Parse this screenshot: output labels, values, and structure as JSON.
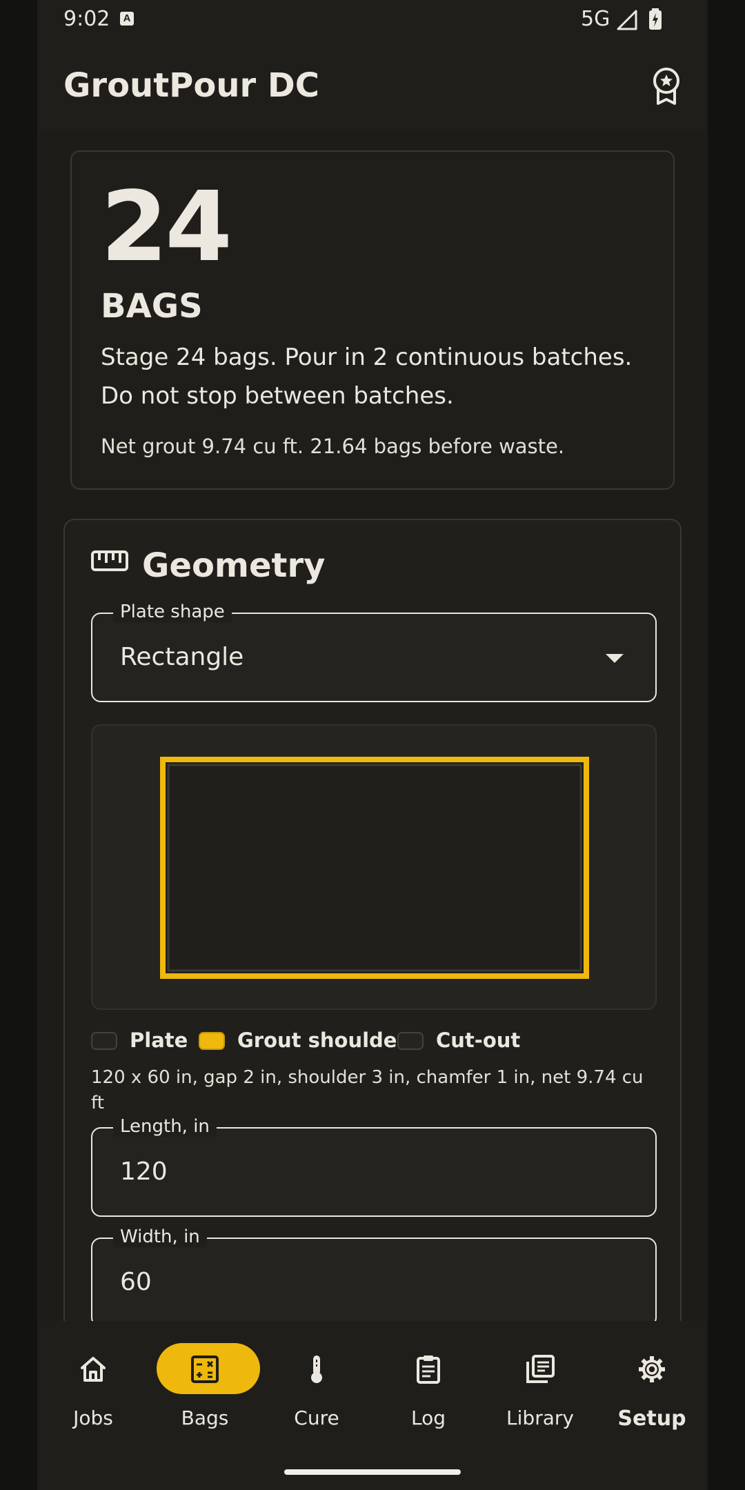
{
  "status_bar": {
    "time": "9:02",
    "notification_icon": "A",
    "network": "5G",
    "signal_icon": "signal-icon",
    "battery_icon": "battery-charging-icon"
  },
  "app_bar": {
    "title": "GroutPour DC",
    "action_icon": "award-icon"
  },
  "result": {
    "bag_count": "24",
    "unit": "BAGS",
    "instruction": "Stage 24 bags. Pour in 2 continuous batches. Do not stop between batches.",
    "net_summary": "Net grout 9.74 cu ft. 21.64 bags before waste."
  },
  "geometry": {
    "title": "Geometry",
    "icon": "ruler-icon",
    "plate_shape_label": "Plate shape",
    "plate_shape_value": "Rectangle",
    "legend": [
      {
        "label": "Plate",
        "color": "#26241f"
      },
      {
        "label": "Grout shoulder",
        "color": "#efb80d"
      },
      {
        "label": "Cut-out",
        "color": "#26241f"
      }
    ],
    "dims_summary": "120 x 60 in, gap 2 in, shoulder 3 in, chamfer 1 in, net 9.74 cu ft",
    "length_label": "Length, in",
    "length_value": "120",
    "width_label": "Width, in",
    "width_value": "60"
  },
  "nav": {
    "items": [
      {
        "label": "Jobs",
        "icon": "home-icon",
        "active": false
      },
      {
        "label": "Bags",
        "icon": "calculator-icon",
        "active": true
      },
      {
        "label": "Cure",
        "icon": "thermometer-icon",
        "active": false
      },
      {
        "label": "Log",
        "icon": "clipboard-icon",
        "active": false
      },
      {
        "label": "Library",
        "icon": "library-icon",
        "active": false
      },
      {
        "label": "Setup",
        "icon": "gear-icon",
        "active": false
      }
    ]
  },
  "colors": {
    "accent": "#efb80d",
    "background": "#1d1c19",
    "text": "#ece8df"
  }
}
